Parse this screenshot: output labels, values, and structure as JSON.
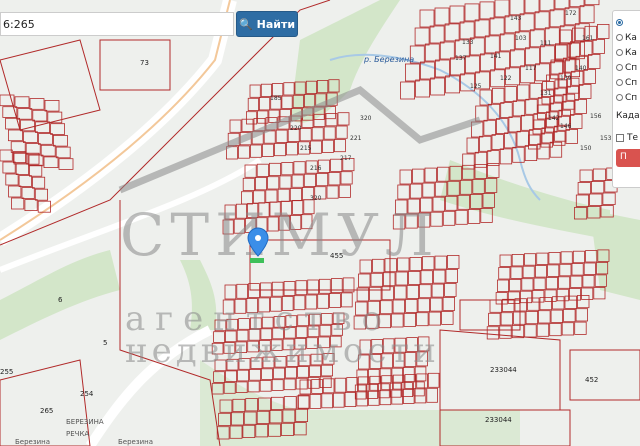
{
  "search": {
    "value": "6:265",
    "button_label": "Найти"
  },
  "panel": {
    "options": [
      {
        "label": "",
        "selected": true
      },
      {
        "label": "Ка",
        "selected": false
      },
      {
        "label": "Ка",
        "selected": false
      },
      {
        "label": "Сп",
        "selected": false
      },
      {
        "label": "Сп",
        "selected": false
      },
      {
        "label": "Сп",
        "selected": false
      }
    ],
    "cadastre_label": "Када",
    "checkbox_label": "Те",
    "button_label": "П"
  },
  "map": {
    "river_label": "р. Березина",
    "watermark_main": "СТИМУЛ",
    "watermark_sub1": "агентство",
    "watermark_sub2": "недвижимости",
    "streets": [
      "Березина",
      "Березина",
      "БЕРЕЗИНА",
      "РЕЧКА"
    ],
    "parcel_labels": [
      "455",
      "233044",
      "233044",
      "452",
      "254",
      "255",
      "265",
      "73",
      "6",
      "5",
      "133",
      "137",
      "141",
      "143",
      "103",
      "111",
      "117",
      "122",
      "125",
      "131",
      "139",
      "140",
      "142",
      "146",
      "150",
      "153",
      "156",
      "161",
      "172",
      "185",
      "220",
      "215",
      "216",
      "217",
      "221",
      "320",
      "320"
    ],
    "colors": {
      "background": "#eef0ed",
      "green": "#cfe3c6",
      "parcel": "#b12a2a",
      "road": "#ffffff",
      "water": "#a8c9e6",
      "marker": "#3b8ee8"
    }
  }
}
